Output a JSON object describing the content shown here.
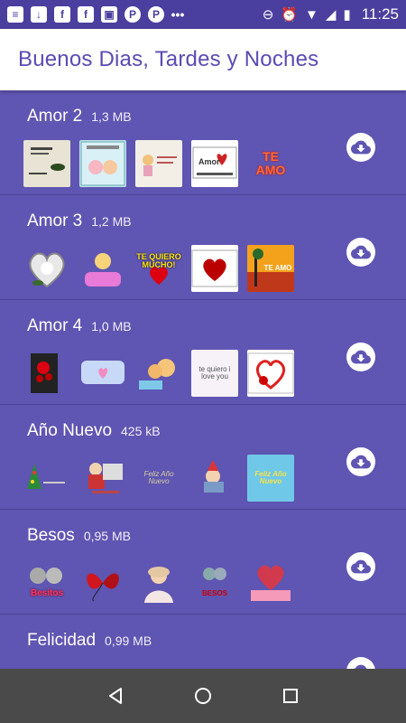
{
  "status_bar": {
    "time": "11:25",
    "icons_left": [
      "message-icon",
      "download-icon",
      "facebook-icon",
      "facebook-icon",
      "gallery-icon",
      "pinterest-icon",
      "pinterest-icon",
      "more-dots-icon"
    ],
    "icons_right": [
      "block-icon",
      "alarm-icon",
      "wifi-icon",
      "signal-icon",
      "battery-icon"
    ]
  },
  "app_bar": {
    "title": "Buenos Dias, Tardes y Noches"
  },
  "packs": [
    {
      "name": "Amor 2",
      "size": "1,3 MB"
    },
    {
      "name": "Amor 3",
      "size": "1,2 MB"
    },
    {
      "name": "Amor 4",
      "size": "1,0 MB"
    },
    {
      "name": "Año Nuevo",
      "size": "425 kB"
    },
    {
      "name": "Besos",
      "size": "0,95 MB"
    },
    {
      "name": "Felicidad",
      "size": "0,99 MB"
    }
  ],
  "sticker_text": {
    "amor2_amor": "Amor",
    "amor2_te_amo": "TE AMO",
    "amor3_te_quiero": "TE QUIERO MUCHO!",
    "amor3_te_amo": "TE AMO",
    "amor4_love": "te quiero i love you",
    "anio_feliz": "Feliz Año Nuevo",
    "besos_besitos": "Besitos",
    "besos_besos": "BESOS"
  },
  "colors": {
    "background": "#5f55b2",
    "status_bar": "#4a3f9e",
    "app_bar": "#ffffff",
    "title": "#5b4bb3",
    "nav_bar": "#4a4a4a"
  },
  "nav": {
    "icons": [
      "back-icon",
      "home-icon",
      "recents-icon"
    ]
  }
}
